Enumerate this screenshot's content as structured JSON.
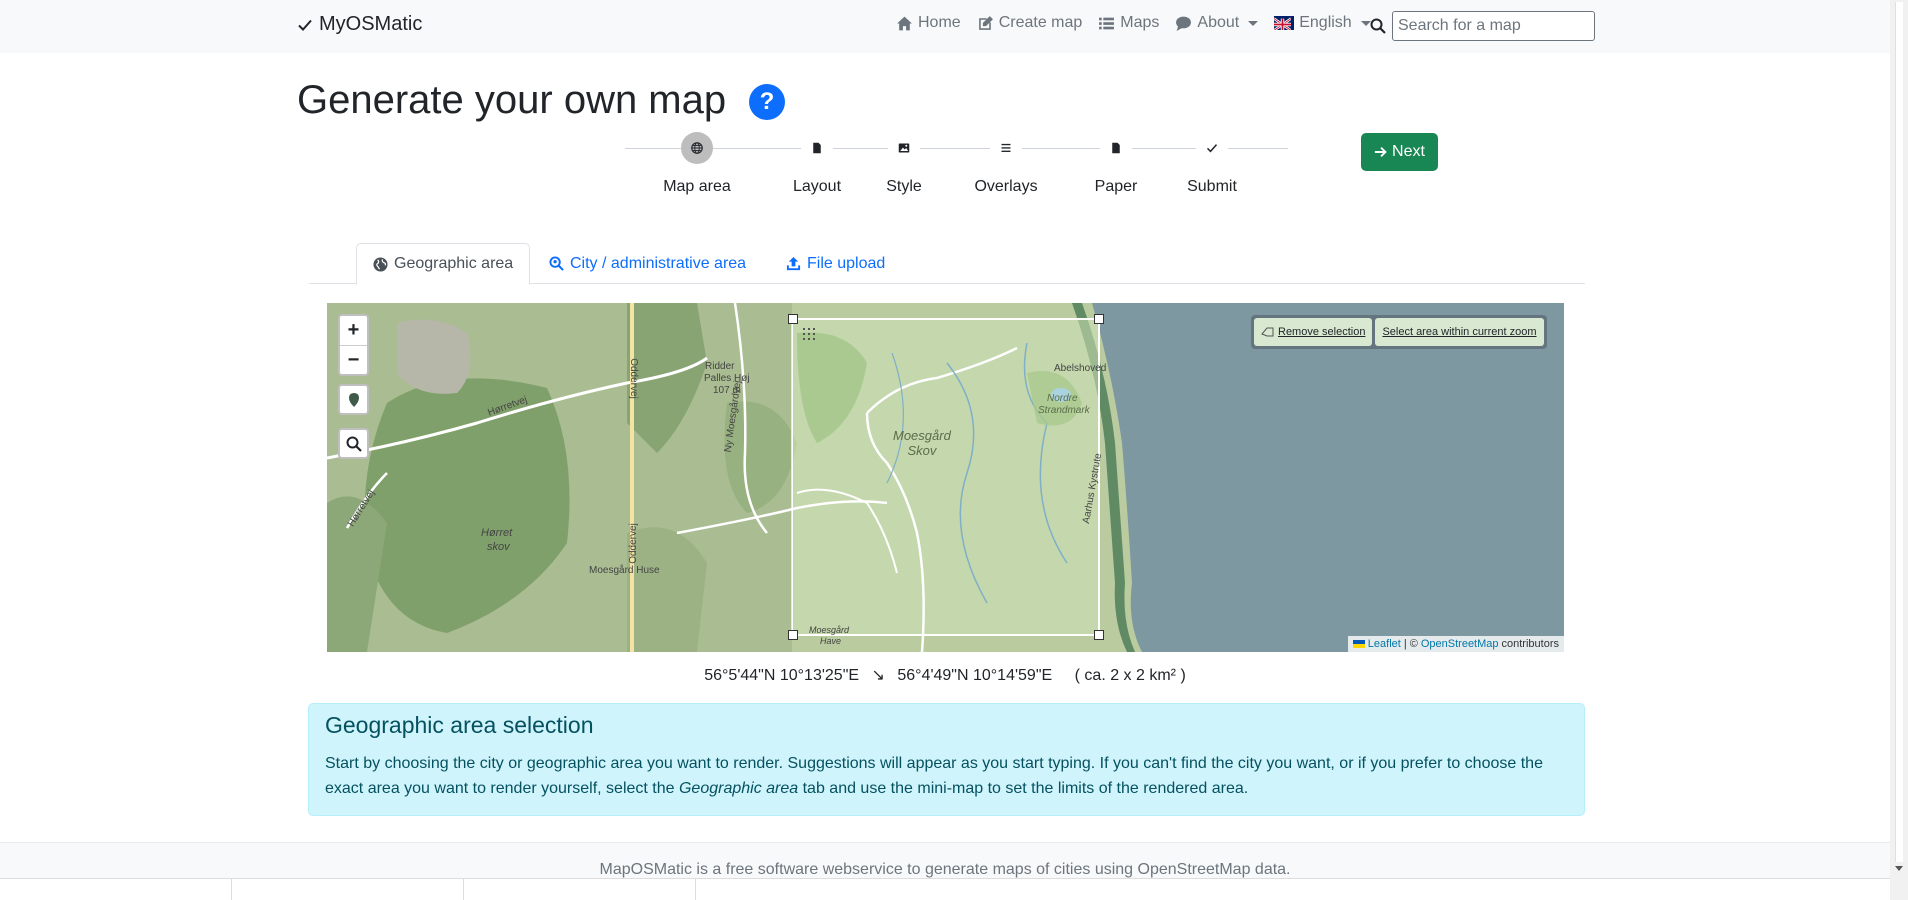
{
  "navbar": {
    "brand": "MyOSMatic",
    "links": {
      "home": "Home",
      "create_map": "Create map",
      "maps": "Maps",
      "about": "About",
      "language": "English"
    },
    "search_placeholder": "Search for a map"
  },
  "page": {
    "title": "Generate your own map"
  },
  "stepper": {
    "steps": [
      {
        "label": "Map area",
        "icon": "globe-icon",
        "active": true
      },
      {
        "label": "Layout",
        "icon": "file-icon",
        "active": false
      },
      {
        "label": "Style",
        "icon": "image-icon",
        "active": false
      },
      {
        "label": "Overlays",
        "icon": "list-icon",
        "active": false
      },
      {
        "label": "Paper",
        "icon": "file-icon",
        "active": false
      },
      {
        "label": "Submit",
        "icon": "check-icon",
        "active": false
      }
    ],
    "next_label": "Next"
  },
  "tabs": [
    {
      "label": "Geographic area",
      "icon": "globe-icon",
      "active": true
    },
    {
      "label": "City / administrative area",
      "icon": "search-location-icon",
      "active": false
    },
    {
      "label": "File upload",
      "icon": "upload-icon",
      "active": false
    }
  ],
  "map": {
    "zoom_in": "+",
    "zoom_out": "−",
    "remove_selection": "Remove selection",
    "select_area": "Select area within current zoom",
    "attribution": {
      "leaflet": "Leaflet",
      "separator": "| ©",
      "osm": "OpenStreetMap",
      "contributors": "contributors"
    },
    "labels": {
      "ridder": "Ridder",
      "pallesh": "Palles Høj",
      "height": "107 m",
      "horretvej": "Hørretvej",
      "horretvej2": "Hørretvej",
      "horret_skov_1": "Hørret",
      "horret_skov_2": "skov",
      "moesgaard_huse": "Moesgård Huse",
      "moesgaard_skov_1": "Moesgård",
      "moesgaard_skov_2": "Skov",
      "abelshoved": "Abelshoved",
      "nordre_1": "Nordre",
      "nordre_2": "Strandmark",
      "oddervej": "Oddervej",
      "oddervej2": "Oddervej",
      "ny_moesgaardvej": "Ny Moesgårdvej",
      "kystvej": "Aarhus Kystrute",
      "moesgaard_have_1": "Moesgård",
      "moesgaard_have_2": "Have"
    }
  },
  "coords": {
    "top_left": "56°5'44\"N 10°13'25\"E",
    "arrow": "↘",
    "bottom_right": "56°4'49\"N 10°14'59\"E",
    "size": "( ca. 2 x 2 km² )"
  },
  "info": {
    "title": "Geographic area selection",
    "text_before": "Start by choosing the city or geographic area you want to render. Suggestions will appear as you start typing. If you can't find the city you want, or if you prefer to choose the exact area you want to render yourself, select the ",
    "text_em": "Geographic area",
    "text_after": " tab and use the mini-map to set the limits of the rendered area."
  },
  "footer": {
    "text": "MapOSMatic is a free software webservice to generate maps of cities using OpenStreetMap data."
  },
  "colors": {
    "primary": "#0d6efd",
    "success": "#198754",
    "info_bg": "#cff4fc",
    "info_text": "#055160"
  }
}
